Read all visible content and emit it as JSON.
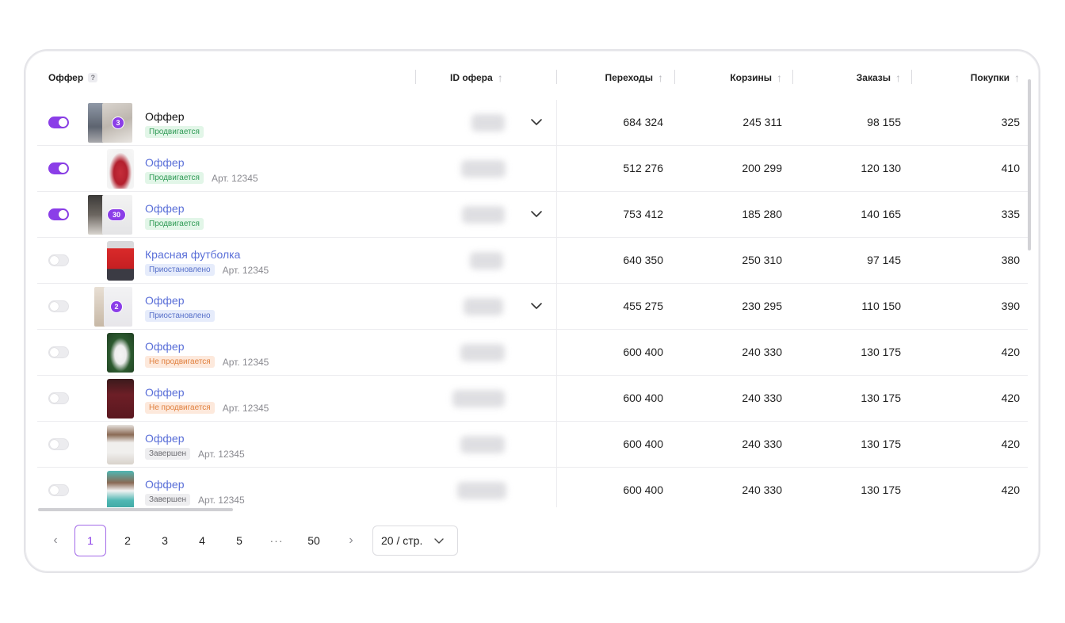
{
  "header": {
    "offer": "Оффер",
    "help": "?",
    "offer_id": "ID офера",
    "clicks": "Переходы",
    "carts": "Корзины",
    "orders": "Заказы",
    "purchases": "Покупки"
  },
  "rows": [
    {
      "toggle": "on",
      "count": "3",
      "name": "Оффер",
      "status": "Продвигается",
      "status_color": "green",
      "article": "",
      "clicks": "684 324",
      "carts": "245 311",
      "orders": "98 155",
      "purchases": "325",
      "expandable": true
    },
    {
      "toggle": "on",
      "count": "",
      "name": "Оффер",
      "status": "Продвигается",
      "status_color": "green",
      "article": "Арт. 12345",
      "clicks": "512 276",
      "carts": "200 299",
      "orders": "120 130",
      "purchases": "410",
      "expandable": false
    },
    {
      "toggle": "on",
      "count": "30",
      "name": "Оффер",
      "status": "Продвигается",
      "status_color": "green",
      "article": "",
      "clicks": "753 412",
      "carts": "185 280",
      "orders": "140 165",
      "purchases": "335",
      "expandable": true
    },
    {
      "toggle": "off",
      "count": "",
      "name": "Красная футболка",
      "status": "Приостановлено",
      "status_color": "blue",
      "article": "Арт. 12345",
      "clicks": "640 350",
      "carts": "250 310",
      "orders": "97 145",
      "purchases": "380",
      "expandable": false
    },
    {
      "toggle": "off",
      "count": "2",
      "name": "Оффер",
      "status": "Приостановлено",
      "status_color": "blue",
      "article": "",
      "clicks": "455 275",
      "carts": "230 295",
      "orders": "110 150",
      "purchases": "390",
      "expandable": true
    },
    {
      "toggle": "off",
      "count": "",
      "name": "Оффер",
      "status": "Не продвигается",
      "status_color": "orange",
      "article": "Арт. 12345",
      "clicks": "600 400",
      "carts": "240 330",
      "orders": "130 175",
      "purchases": "420",
      "expandable": false
    },
    {
      "toggle": "off",
      "count": "",
      "name": "Оффер",
      "status": "Не продвигается",
      "status_color": "orange",
      "article": "Арт. 12345",
      "clicks": "600 400",
      "carts": "240 330",
      "orders": "130 175",
      "purchases": "420",
      "expandable": false
    },
    {
      "toggle": "off",
      "count": "",
      "name": "Оффер",
      "status": "Завершен",
      "status_color": "gray",
      "article": "Арт. 12345",
      "clicks": "600 400",
      "carts": "240 330",
      "orders": "130 175",
      "purchases": "420",
      "expandable": false
    },
    {
      "toggle": "off",
      "count": "",
      "name": "Оффер",
      "status": "Завершен",
      "status_color": "gray",
      "article": "Арт. 12345",
      "clicks": "600 400",
      "carts": "240 330",
      "orders": "130 175",
      "purchases": "420",
      "expandable": false
    }
  ],
  "pagination": {
    "prev": "‹",
    "pages": [
      "1",
      "2",
      "3",
      "4",
      "5"
    ],
    "dots": "···",
    "last": "50",
    "next": "›",
    "current": "1",
    "page_size": "20 / стр."
  },
  "colors": {
    "accent": "#8b3ee8",
    "link": "#5a6fd8"
  }
}
